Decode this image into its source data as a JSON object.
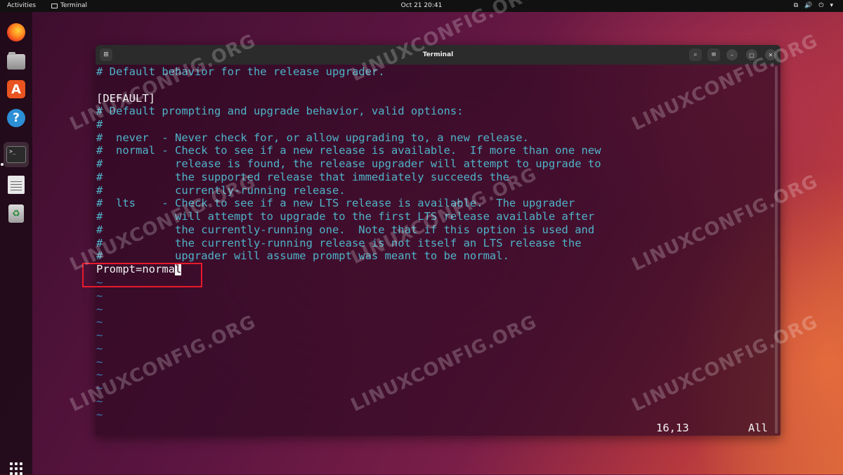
{
  "topbar": {
    "activities": "Activities",
    "app_name": "Terminal",
    "clock": "Oct 21  20:41",
    "tray": {
      "network": "⧉",
      "volume": "🔊",
      "power": "⏻",
      "menu": "▾"
    }
  },
  "dock": {
    "items": [
      "Firefox",
      "Files",
      "Ubuntu Software",
      "Help",
      "Terminal",
      "Text Editor",
      "Trash"
    ],
    "store_glyph": "A",
    "help_glyph": "?",
    "terminal_glyph": ">_",
    "trash_glyph": "♻"
  },
  "window": {
    "title": "Terminal",
    "buttons": {
      "new_tab": "⊞",
      "search": "⌕",
      "menu": "≡",
      "minimize": "–",
      "maximize": "□",
      "close": "✕"
    }
  },
  "editor": {
    "lines": [
      "# Default behavior for the release upgrader.",
      "",
      "[DEFAULT]",
      "# Default prompting and upgrade behavior, valid options:",
      "#",
      "#  never  - Never check for, or allow upgrading to, a new release.",
      "#  normal - Check to see if a new release is available.  If more than one new",
      "#           release is found, the release upgrader will attempt to upgrade to",
      "#           the supported release that immediately succeeds the",
      "#           currently-running release.",
      "#  lts    - Check to see if a new LTS release is available.  The upgrader",
      "#           will attempt to upgrade to the first LTS release available after",
      "#           the currently-running one.  Note that if this option is used and",
      "#           the currently-running release is not itself an LTS release the",
      "#           upgrader will assume prompt was meant to be normal."
    ],
    "prompt_line_before": "Prompt=norma",
    "prompt_line_cursor": "l",
    "tilde": "~",
    "status_position": "16,13",
    "status_scroll": "All"
  },
  "watermark": "LINUXCONFIG.ORG",
  "colors": {
    "comment": "#4fb3c9",
    "text": "#f2f2f2",
    "tilde": "#3e7fb3",
    "highlight": "#e8192c"
  }
}
